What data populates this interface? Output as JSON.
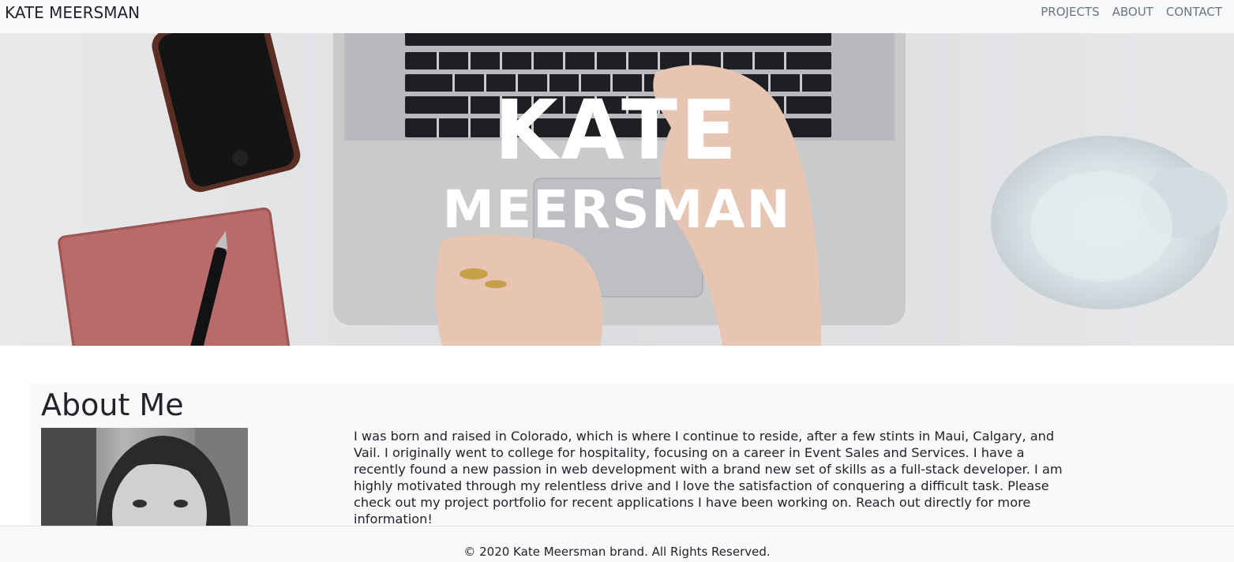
{
  "navbar": {
    "brand": "KATE MEERSMAN",
    "links": [
      "PROJECTS",
      "ABOUT",
      "CONTACT"
    ]
  },
  "hero": {
    "first_name": "KATE",
    "last_name": "MEERSMAN",
    "image": "desk-laptop-photo"
  },
  "about": {
    "heading": "About Me",
    "photo": "profile-photo",
    "bio": "I was born and raised in Colorado, which is where I continue to reside, after a few stints in Maui, Calgary, and Vail. I originally went to college for hospitality, focusing on a career in Event Sales and Services. I have a recently found a new passion in web development with a brand new set of skills as a full-stack developer. I am highly motivated through my relentless drive and I love the satisfaction of conquering a difficult task. Please check out my project portfolio for recent applications I have been working on. Reach out directly for more information!"
  },
  "footer": {
    "copyright": "© 2020 Kate Meersman brand. All Rights Reserved."
  },
  "colors": {
    "navbar_bg": "#f8f9fa",
    "nav_link": "#6c757d",
    "text": "#212529",
    "hero_text": "#ffffff"
  }
}
